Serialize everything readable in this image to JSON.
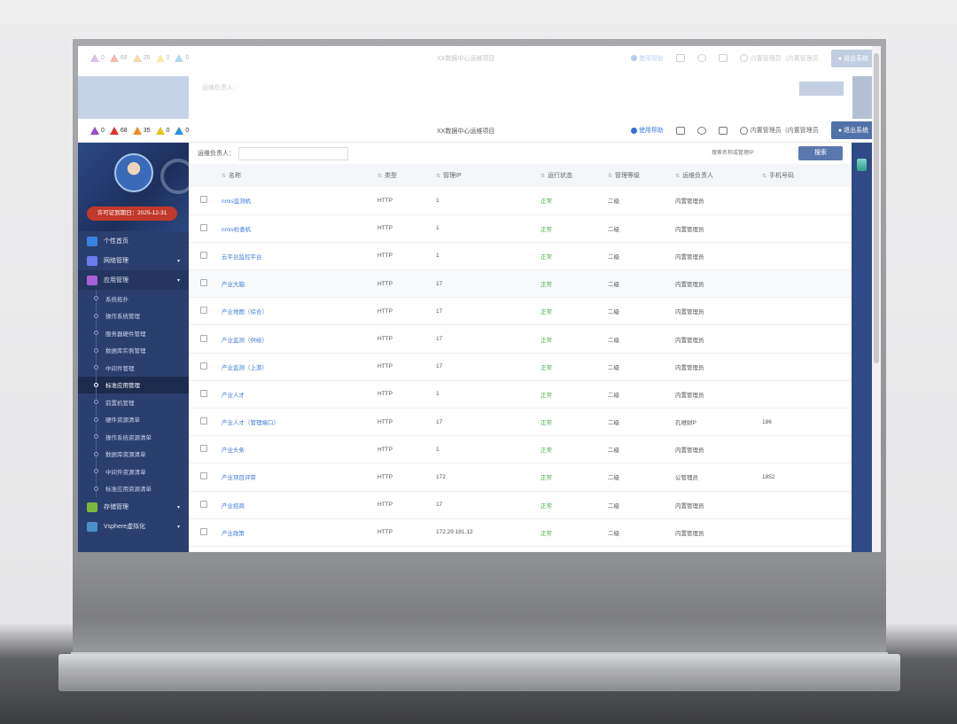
{
  "alerts": [
    {
      "count": "0",
      "color": "#9b4bc9"
    },
    {
      "count": "68",
      "color": "#e0342b"
    },
    {
      "count": "35",
      "color": "#f08c1f"
    },
    {
      "count": "0",
      "color": "#e5c21b"
    },
    {
      "count": "0",
      "color": "#2f8fe0"
    }
  ],
  "header": {
    "title": "XX数据中心运维项目",
    "help": "使用帮助",
    "user": "内置管理员（内置管理员",
    "logout": "● 退出系统"
  },
  "sidebar": {
    "license": "许可证到期日：2025-12-31",
    "groups": [
      {
        "label": "个性首页",
        "color": "#3b82e0",
        "icon": "home-icon"
      },
      {
        "label": "网络管理",
        "color": "#6a7bf0",
        "icon": "network-icon"
      },
      {
        "label": "应用管理",
        "color": "#a860d8",
        "icon": "monitor-icon"
      }
    ],
    "sub_items": [
      "系统拓扑",
      "操作系统管理",
      "服务器硬件管理",
      "数据库实例管理",
      "中间件管理",
      "标准应用管理",
      "前置机管理",
      "硬件资源清单",
      "操作系统资源清单",
      "数据库资源清单",
      "中间件资源清单",
      "标准应用资源清单"
    ],
    "bottom_groups": [
      {
        "label": "存储管理",
        "color": "#7cb83e",
        "icon": "storage-icon"
      },
      {
        "label": "Vsphere虚拟化",
        "color": "#4a90c8",
        "icon": "virtualization-icon"
      }
    ]
  },
  "filter": {
    "label": "运维负责人：",
    "search_placeholder": "搜索名称或管理IP",
    "button": "搜索"
  },
  "table": {
    "columns": [
      "名称",
      "类型",
      "管理IP",
      "运行状态",
      "管理等级",
      "运维负责人",
      "手机号码"
    ],
    "rows": [
      [
        "nmis监测机",
        "HTTP",
        "1",
        "正常",
        "二级",
        "内置管理员",
        ""
      ],
      [
        "nmis检查机",
        "HTTP",
        "1",
        "正常",
        "二级",
        "内置管理员",
        ""
      ],
      [
        "云平台监控平台",
        "HTTP",
        "1",
        "正常",
        "二级",
        "内置管理员",
        ""
      ],
      [
        "产业大脑",
        "HTTP",
        "17",
        "正常",
        "二级",
        "内置管理员",
        ""
      ],
      [
        "产业地图（综合）",
        "HTTP",
        "17",
        "正常",
        "二级",
        "内置管理员",
        ""
      ],
      [
        "产业监测（供给）",
        "HTTP",
        "17",
        "正常",
        "二级",
        "内置管理员",
        ""
      ],
      [
        "产业监测（上游）",
        "HTTP",
        "17",
        "正常",
        "二级",
        "内置管理员",
        ""
      ],
      [
        "产业人才",
        "HTTP",
        "1",
        "正常",
        "二级",
        "内置管理员",
        ""
      ],
      [
        "产业人才（管理端口）",
        "HTTP",
        "17",
        "正常",
        "二级",
        "孔维财P",
        "186"
      ],
      [
        "产业头条",
        "HTTP",
        "1",
        "正常",
        "二级",
        "内置管理员",
        ""
      ],
      [
        "产业项目评审",
        "HTTP",
        "172",
        "正常",
        "二级",
        "公管理员",
        "1852"
      ],
      [
        "产业招商",
        "HTTP",
        "17",
        "正常",
        "二级",
        "内置管理员",
        ""
      ],
      [
        "产业政策",
        "HTTP",
        "172.29.181.12",
        "正常",
        "二级",
        "内置管理员",
        ""
      ]
    ]
  }
}
